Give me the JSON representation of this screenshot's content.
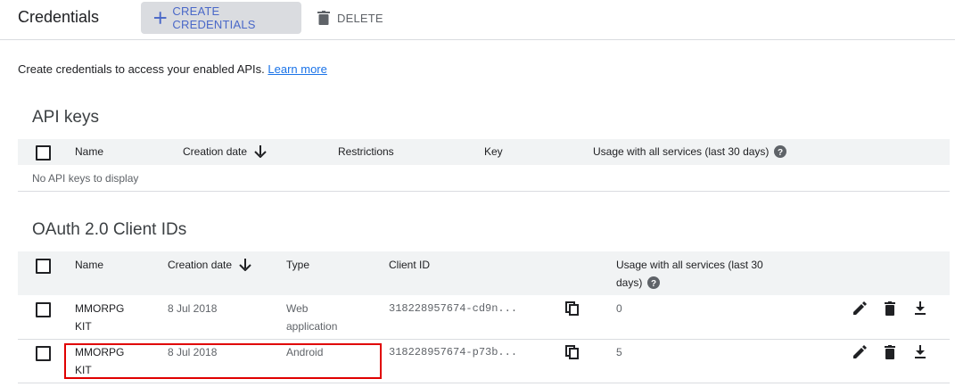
{
  "header": {
    "title": "Credentials",
    "create_label": "CREATE CREDENTIALS",
    "delete_label": "DELETE"
  },
  "intro": {
    "text": "Create credentials to access your enabled APIs.",
    "link": "Learn more"
  },
  "api_keys": {
    "title": "API keys",
    "columns": [
      "Name",
      "Creation date",
      "Restrictions",
      "Key",
      "Usage with all services (last 30 days)"
    ],
    "empty": "No API keys to display"
  },
  "oauth": {
    "title": "OAuth 2.0 Client IDs",
    "columns": [
      "Name",
      "Creation date",
      "Type",
      "Client ID",
      "Usage with all services (last 30",
      "days)"
    ],
    "rows": [
      {
        "name_1": "MMORPG",
        "name_2": "KIT",
        "date": "8 Jul 2018",
        "type_1": "Web",
        "type_2": "application",
        "client_id": "318228957674-cd9n...",
        "usage": "0"
      },
      {
        "name_1": "MMORPG",
        "name_2": "KIT",
        "date": "8 Jul 2018",
        "type_1": "Android",
        "type_2": "",
        "client_id": "318228957674-p73b...",
        "usage": "5"
      }
    ]
  },
  "colors": {
    "accent": "#1a73e8",
    "highlight": "#e00000"
  },
  "icons": [
    "plus-icon",
    "trash-icon",
    "arrow-down-icon",
    "help-icon",
    "copy-icon",
    "edit-icon",
    "delete-icon",
    "download-icon"
  ]
}
